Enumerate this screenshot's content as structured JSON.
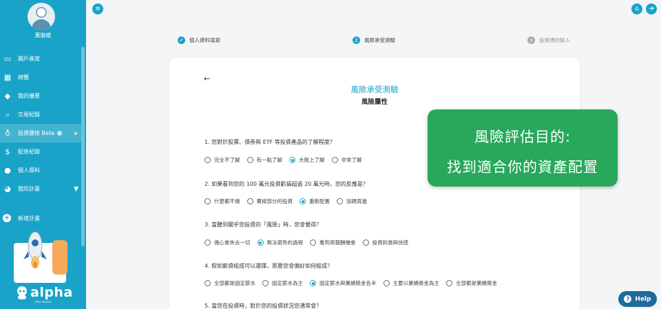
{
  "user": {
    "name": "黃御維"
  },
  "sidebar": {
    "items": [
      {
        "label": "開戶進度",
        "icon": "id-card-icon",
        "glyph": "▭"
      },
      {
        "label": "總覽",
        "icon": "grid-icon",
        "glyph": "▦"
      },
      {
        "label": "我的優惠",
        "icon": "tag-icon",
        "glyph": "◆"
      },
      {
        "label": "交易紀錄",
        "icon": "search-icon",
        "glyph": "⌕"
      },
      {
        "label": "投資健檢 Beta",
        "icon": "stethoscope-icon",
        "glyph": "♁"
      },
      {
        "label": "配息紀錄",
        "icon": "dollar-icon",
        "glyph": "$"
      },
      {
        "label": "個人資料",
        "icon": "user-icon",
        "glyph": "●"
      },
      {
        "label": "我的計畫",
        "icon": "pie-chart-icon",
        "glyph": "◕"
      }
    ],
    "new_plan": "新增計畫",
    "logo_text": "alpha",
    "logo_sub": "robo-advisor"
  },
  "stepper": {
    "steps": [
      {
        "num": "✓",
        "label": "個人資料填寫"
      },
      {
        "num": "2",
        "label": "風險承受測驗"
      },
      {
        "num": "3",
        "label": "投資標的輸入"
      }
    ]
  },
  "card": {
    "title": "風險承受測驗",
    "subtitle": "風險屬性",
    "questions": [
      {
        "text": "1. 您對於股票、債券與 ETF 等投資產品的了解程度？",
        "options": [
          "完全不了解",
          "有一點了解",
          "大致上了解",
          "非常了解"
        ],
        "selected": 2
      },
      {
        "text": "2. 如果看到您的 100 萬元投資虧損超過 20 萬元時，您的反應是？",
        "options": [
          "什麼都不做",
          "賣掉部分的投資",
          "重新配置",
          "加碼買進"
        ],
        "selected": 2
      },
      {
        "text": "3. 當聽到關乎您投資的「風險」時，您會覺得？",
        "options": [
          "擔心會失去一切",
          "無法避免的過程",
          "看到高報酬機會",
          "投資刺激與快感"
        ],
        "selected": 1
      },
      {
        "text": "4. 假如薪資組成可以選擇，那麼您會偏好如何組成？",
        "options": [
          "全部都是固定薪水",
          "固定薪水為主",
          "固定薪水與業績獎金各半",
          "主要以業績獎金為主",
          "全部都是業績獎金"
        ],
        "selected": 2
      },
      {
        "text": "5. 當您在投資時，對於您的投資狀況您通常會？",
        "options": [],
        "selected": -1
      }
    ]
  },
  "overlay": {
    "line1": "風險評估目的:",
    "line2": "找到適合你的資產配置"
  },
  "help": {
    "label": "Help"
  },
  "colors": {
    "primary": "#1aa3c9",
    "overlay_green": "#27a85a",
    "help_blue": "#1f6b9a"
  }
}
